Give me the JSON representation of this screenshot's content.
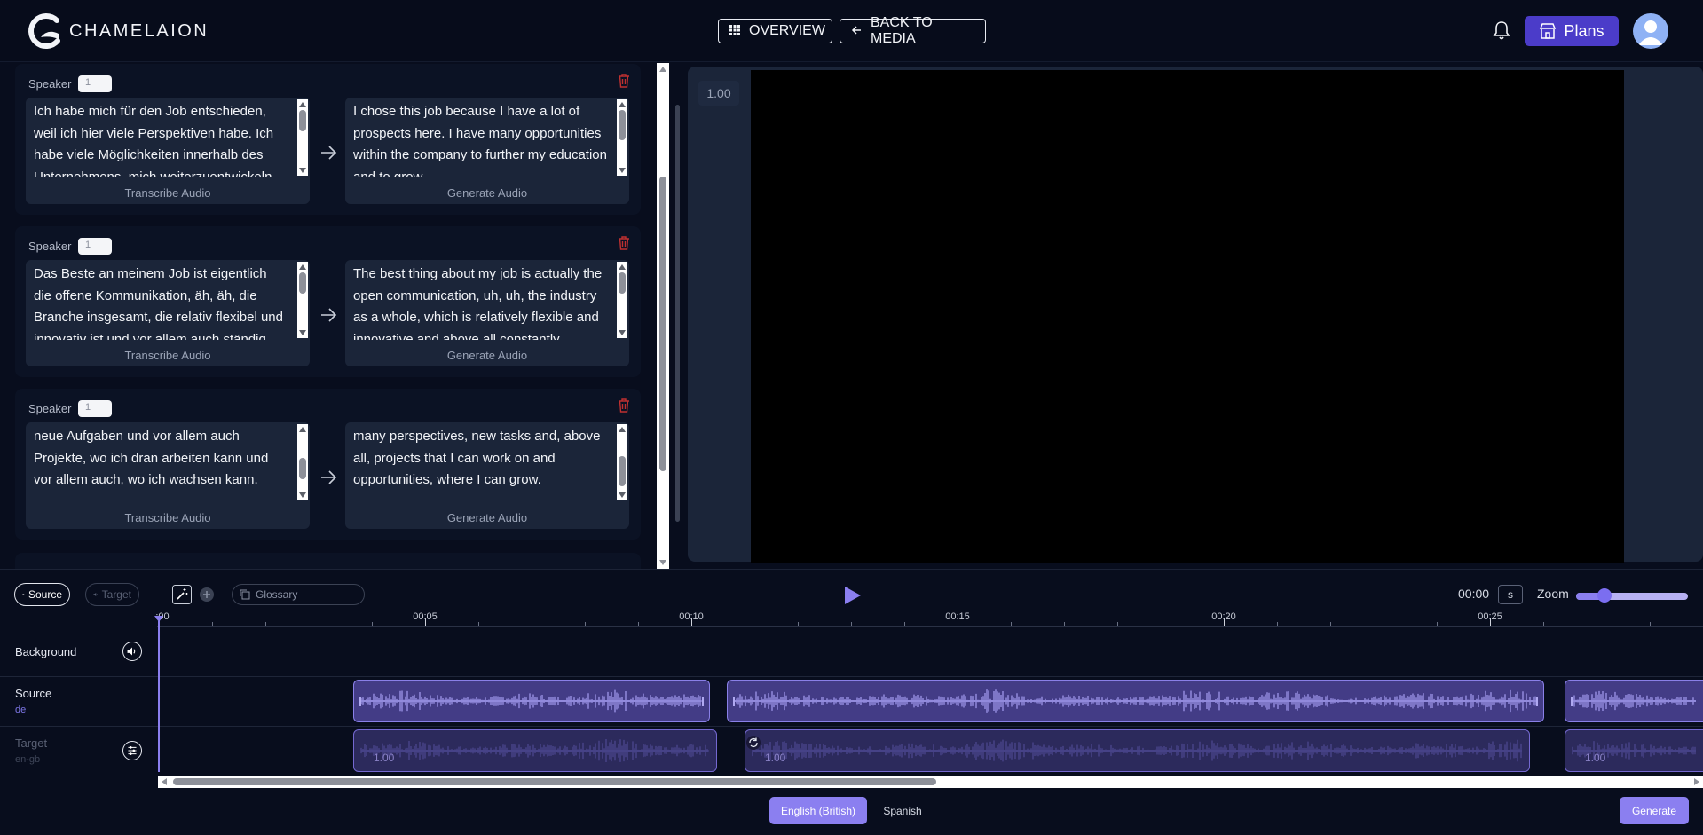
{
  "app": {
    "name": "CHAMELAION"
  },
  "header": {
    "overview_label": "OVERVIEW",
    "back_label": "BACK TO MEDIA",
    "plans_label": "Plans"
  },
  "segments": [
    {
      "speaker_label": "Speaker",
      "speaker_value": "1",
      "source_text": "Ich habe mich für den Job entschieden, weil ich hier viele Perspektiven habe. Ich habe viele Möglichkeiten innerhalb des Unternehmens, mich weiterzuentwickeln",
      "target_text": "I chose this job because I have a lot of prospects here. I have many opportunities within the company to further my education and to grow",
      "source_action": "Transcribe Audio",
      "target_action": "Generate Audio"
    },
    {
      "speaker_label": "Speaker",
      "speaker_value": "1",
      "source_text": "Das Beste an meinem Job ist eigentlich die offene Kommunikation, äh, äh, die Branche insgesamt, die relativ flexibel und innovativ ist und vor allem auch ständig wachsend",
      "target_text": "The best thing about my job is actually the open communication, uh, uh, the industry as a whole, which is relatively flexible and innovative and above all constantly growing",
      "source_action": "Transcribe Audio",
      "target_action": "Generate Audio"
    },
    {
      "speaker_label": "Speaker",
      "speaker_value": "1",
      "source_text": "neue Aufgaben und vor allem auch Projekte, wo ich dran arbeiten kann und vor allem auch, wo ich wachsen kann.",
      "target_text": "many perspectives, new tasks and, above all, projects that I can work on and opportunities, where I can grow.",
      "source_action": "Transcribe Audio",
      "target_action": "Generate Audio"
    }
  ],
  "video": {
    "speed": "1.00"
  },
  "timeline": {
    "source_toggle": "Source",
    "target_toggle": "Target",
    "glossary_placeholder": "Glossary",
    "time": "00:00",
    "unit": "s",
    "zoom_label": "Zoom",
    "zoom_level": 0.25,
    "ruler_labels": [
      ":00",
      "00:05",
      "00:10",
      "00:15",
      "00:20",
      "00:25"
    ],
    "tracks": {
      "background": {
        "name": "Background"
      },
      "source": {
        "name": "Source",
        "lang": "de"
      },
      "target": {
        "name": "Target",
        "lang": "en-gb"
      }
    },
    "clip_speed": "1.00"
  },
  "languages": {
    "active": "English (British)",
    "inactive": "Spanish"
  },
  "generate_label": "Generate",
  "colors": {
    "accent": "#8b7ff0",
    "plans": "#4b3cc9",
    "background": "#080d1d",
    "panel": "#1b2539"
  }
}
